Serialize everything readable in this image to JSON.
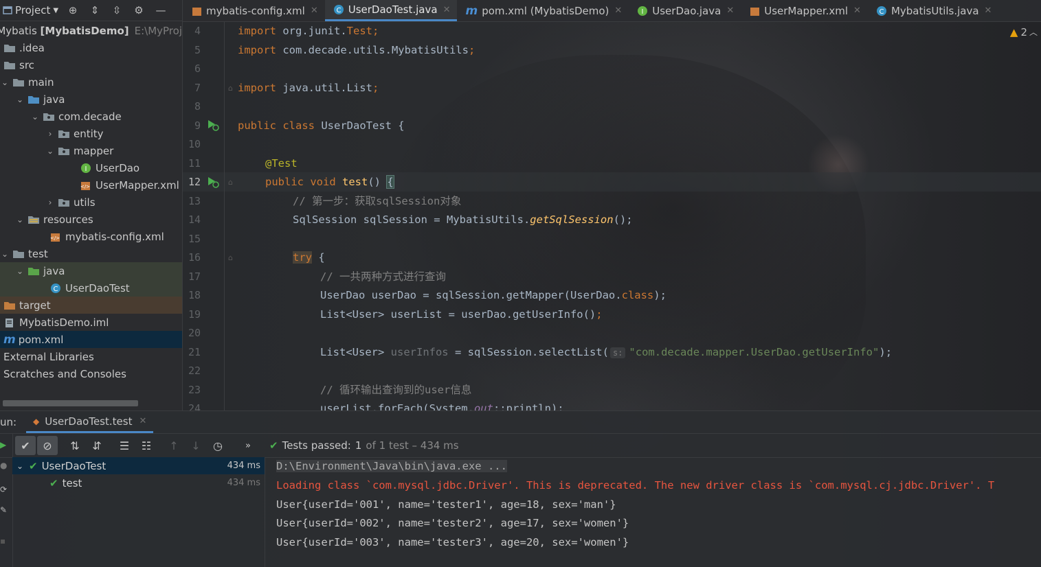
{
  "project_panel": {
    "title": "Project",
    "tree": [
      {
        "label": "Mybatis",
        "bold": "[MybatisDemo]",
        "extra": "E:\\MyProj",
        "icon": "module-icon"
      },
      {
        "label": ".idea",
        "icon": "folder-icon"
      },
      {
        "label": "src",
        "icon": "folder-icon"
      },
      {
        "label": "main",
        "icon": "folder-icon"
      },
      {
        "label": "java",
        "icon": "source-folder-icon"
      },
      {
        "label": "com.decade",
        "icon": "package-icon"
      },
      {
        "label": "entity",
        "icon": "package-icon"
      },
      {
        "label": "mapper",
        "icon": "package-icon"
      },
      {
        "label": "UserDao",
        "icon": "interface-icon"
      },
      {
        "label": "UserMapper.xml",
        "icon": "xml-icon"
      },
      {
        "label": "utils",
        "icon": "package-icon"
      },
      {
        "label": "resources",
        "icon": "resources-folder-icon"
      },
      {
        "label": "mybatis-config.xml",
        "icon": "xml-icon"
      },
      {
        "label": "test",
        "icon": "folder-icon"
      },
      {
        "label": "java",
        "icon": "test-folder-icon"
      },
      {
        "label": "UserDaoTest",
        "icon": "class-icon"
      },
      {
        "label": "target",
        "icon": "excluded-folder-icon"
      },
      {
        "label": "MybatisDemo.iml",
        "icon": "iml-icon"
      },
      {
        "label": "pom.xml",
        "icon": "maven-icon"
      },
      {
        "label": "External Libraries",
        "icon": ""
      },
      {
        "label": "Scratches and Consoles",
        "icon": ""
      }
    ]
  },
  "tabs": [
    {
      "label": "mybatis-config.xml",
      "icon": "xml-icon"
    },
    {
      "label": "UserDaoTest.java",
      "icon": "class-icon",
      "active": true
    },
    {
      "label": "pom.xml (MybatisDemo)",
      "icon": "maven-icon"
    },
    {
      "label": "UserDao.java",
      "icon": "interface-icon"
    },
    {
      "label": "UserMapper.xml",
      "icon": "xml-icon"
    },
    {
      "label": "MybatisUtils.java",
      "icon": "class-icon"
    }
  ],
  "editor": {
    "line_numbers": [
      "4",
      "5",
      "6",
      "7",
      "8",
      "9",
      "10",
      "11",
      "12",
      "13",
      "14",
      "15",
      "16",
      "17",
      "18",
      "19",
      "20",
      "21",
      "22",
      "23",
      "24"
    ],
    "current_line": "12",
    "warnings_count": "2",
    "code": {
      "l4": [
        "import ",
        "org.junit.",
        "Test",
        ";"
      ],
      "l5": [
        "import ",
        "com.decade.utils.MybatisUtils",
        ";"
      ],
      "l7": [
        "import ",
        "java.util.List",
        ";"
      ],
      "l9": [
        "public class ",
        "UserDaoTest {"
      ],
      "l11": "@Test",
      "l12": [
        "public void ",
        "test",
        "() ",
        "{"
      ],
      "l13": "// 第一步：获取sqlSession对象",
      "l14": [
        "SqlSession sqlSession = MybatisUtils.",
        "getSqlSession",
        "();"
      ],
      "l16": [
        "try",
        " {"
      ],
      "l17": "// 一共两种方式进行查询",
      "l18": [
        "UserDao userDao = sqlSession.getMapper(UserDao.",
        "class",
        ");"
      ],
      "l19": [
        "List<User> userList = userDao.getUserInfo()",
        ";"
      ],
      "l21": [
        "List<User> ",
        "userInfos",
        " = sqlSession.selectList(",
        "s:",
        "\"com.decade.mapper.UserDao.getUserInfo\"",
        ");"
      ],
      "l23": "// 循环输出查询到的user信息",
      "l24": [
        "userList.forEach(System.",
        "out",
        "::println);"
      ]
    }
  },
  "run_panel": {
    "label": "un:",
    "tab": "UserDaoTest.test",
    "status": "Tests passed:",
    "status_count": "1",
    "status_rest": "of 1 test – 434 ms",
    "tests": [
      {
        "name": "UserDaoTest",
        "time": "434 ms"
      },
      {
        "name": "test",
        "time": "434 ms"
      }
    ],
    "console": [
      "D:\\Environment\\Java\\bin\\java.exe ...",
      "Loading class `com.mysql.jdbc.Driver'. This is deprecated. The new driver class is `com.mysql.cj.jdbc.Driver'. T",
      "User{userId='001', name='tester1', age=18, sex='man'}",
      "User{userId='002', name='tester2', age=17, sex='women'}",
      "User{userId='003', name='tester3', age=20, sex='women'}"
    ]
  }
}
